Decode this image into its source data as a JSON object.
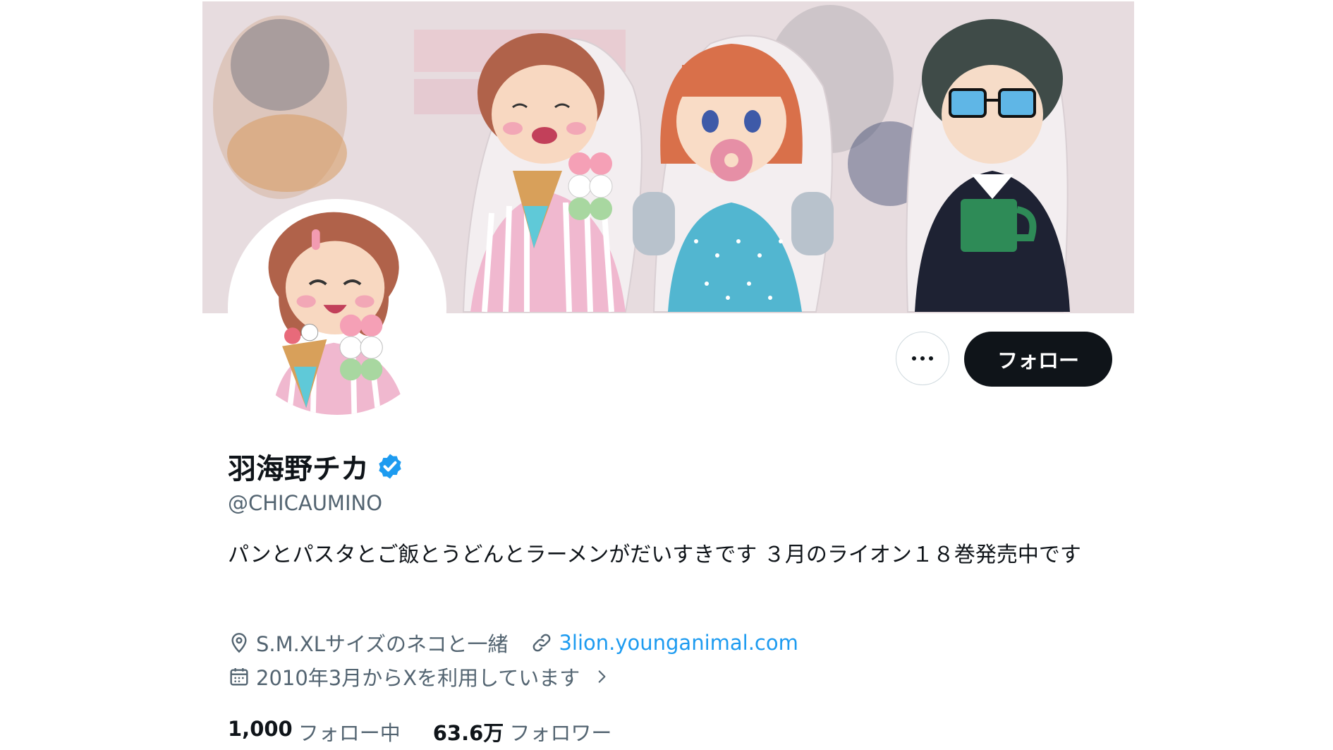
{
  "profile": {
    "display_name": "羽海野チカ",
    "handle": "@CHICAUMINO",
    "bio": "パンとパスタとご飯とうどんとラーメンがだいすきです ３月のライオン１８巻発売中です",
    "location": "S.M.XLサイズのネコと一緒",
    "website": "3lion.younganimal.com",
    "joined": "2010年3月からXを利用しています",
    "following_count": "1,000",
    "following_label": "フォロー中",
    "followers_count": "63.6万",
    "followers_label": "フォロワー"
  },
  "actions": {
    "follow_label": "フォロー"
  },
  "icons": {
    "more": "more-horizontal-icon",
    "verified": "verified-badge-icon",
    "location": "location-pin-icon",
    "link": "link-icon",
    "calendar": "calendar-icon",
    "chevron": "chevron-right-icon"
  },
  "colors": {
    "accent": "#1d9bf0",
    "text_primary": "#0f1419",
    "text_secondary": "#536471",
    "follow_button": "#0f1419"
  }
}
